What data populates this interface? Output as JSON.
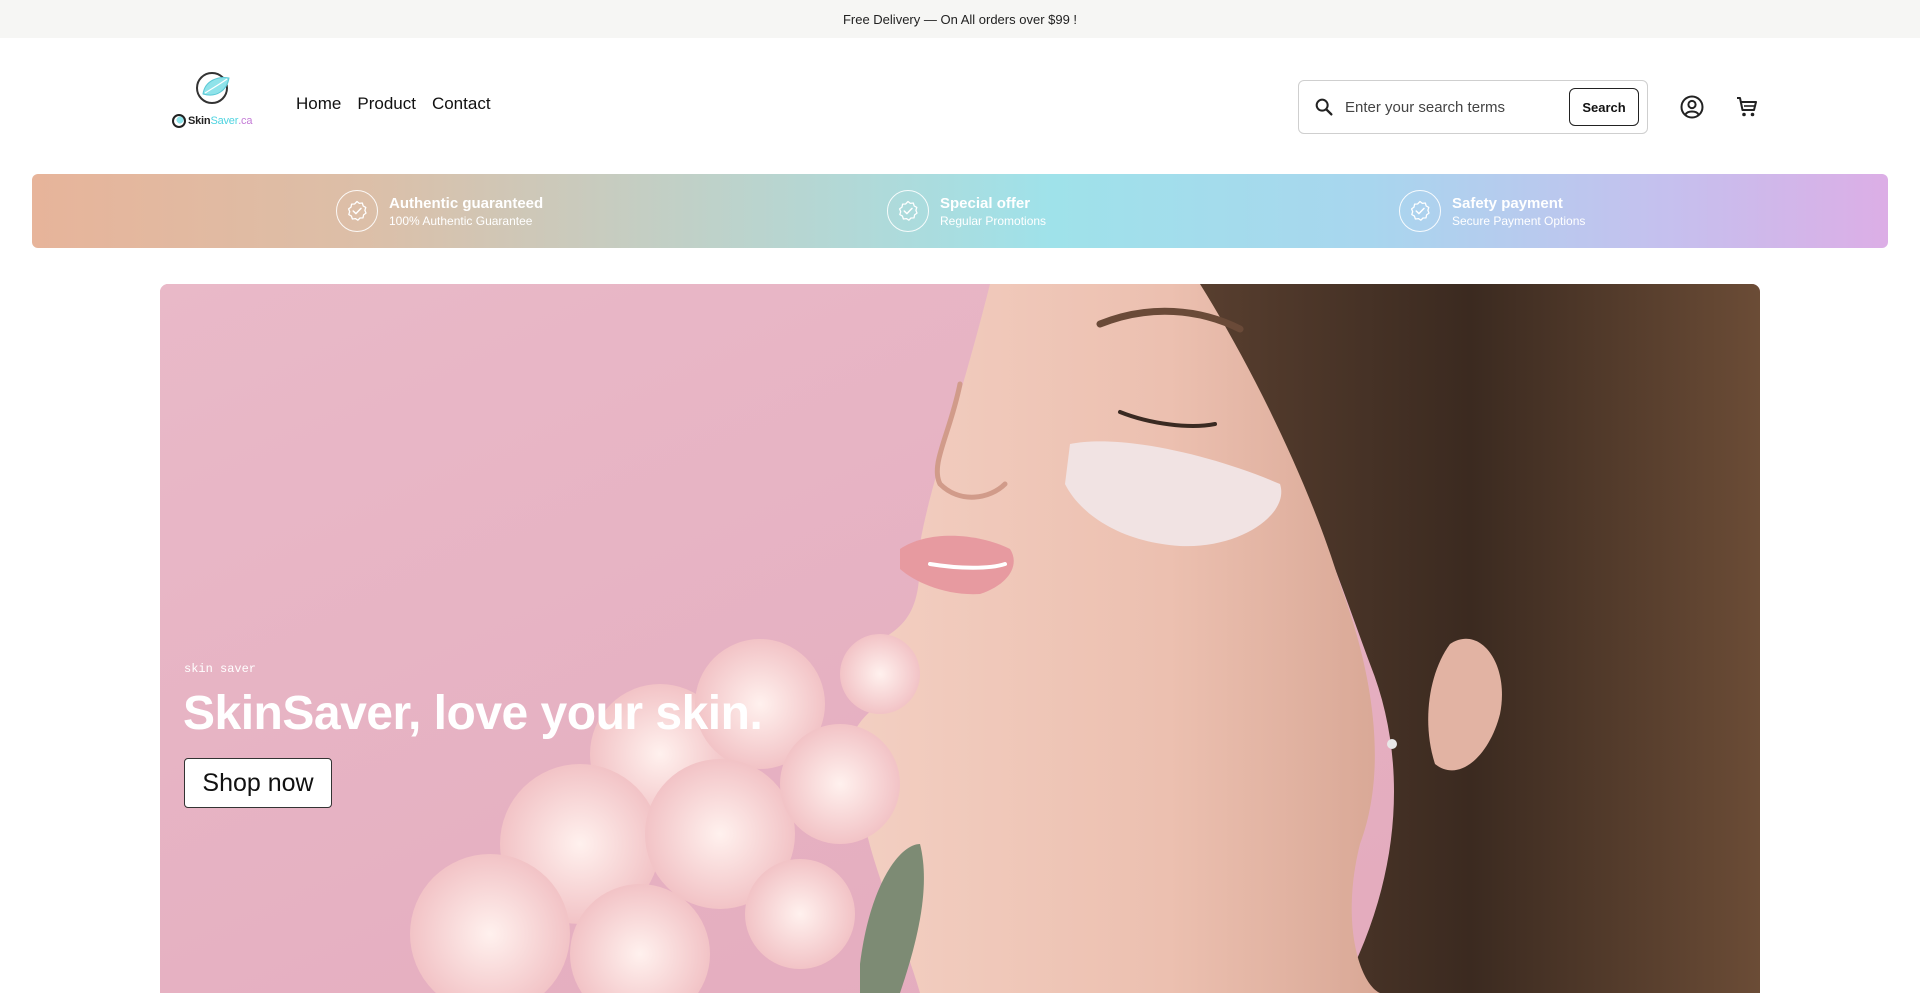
{
  "announcement": {
    "text": "Free Delivery — On All orders over $99 !"
  },
  "logo": {
    "part1": "Skin",
    "part2": "Saver",
    "part3": ".ca"
  },
  "nav": {
    "items": [
      {
        "label": "Home"
      },
      {
        "label": "Product"
      },
      {
        "label": "Contact"
      }
    ]
  },
  "search": {
    "placeholder": "Enter your search terms",
    "value": "",
    "button_label": "Search"
  },
  "header_icons": {
    "account": "account-icon",
    "cart": "cart-icon"
  },
  "trust": {
    "items": [
      {
        "title": "Authentic guaranteed",
        "subtitle": "100% Authentic Guarantee",
        "icon": "badge-check-icon"
      },
      {
        "title": "Special offer",
        "subtitle": "Regular Promotions",
        "icon": "badge-check-icon"
      },
      {
        "title": "Safety payment",
        "subtitle": "Secure Payment Options",
        "icon": "badge-check-icon"
      }
    ]
  },
  "hero": {
    "eyebrow": "skin saver",
    "headline": "SkinSaver, love your skin.",
    "cta_label": "Shop now"
  },
  "colors": {
    "announcement_bg": "#f6f6f4",
    "hero_bg": "#eabcc9",
    "trust_gradient": [
      "#e7b49a",
      "#9fe2ea",
      "#dcaee6"
    ],
    "logo_accent": "#4fd3e0"
  }
}
